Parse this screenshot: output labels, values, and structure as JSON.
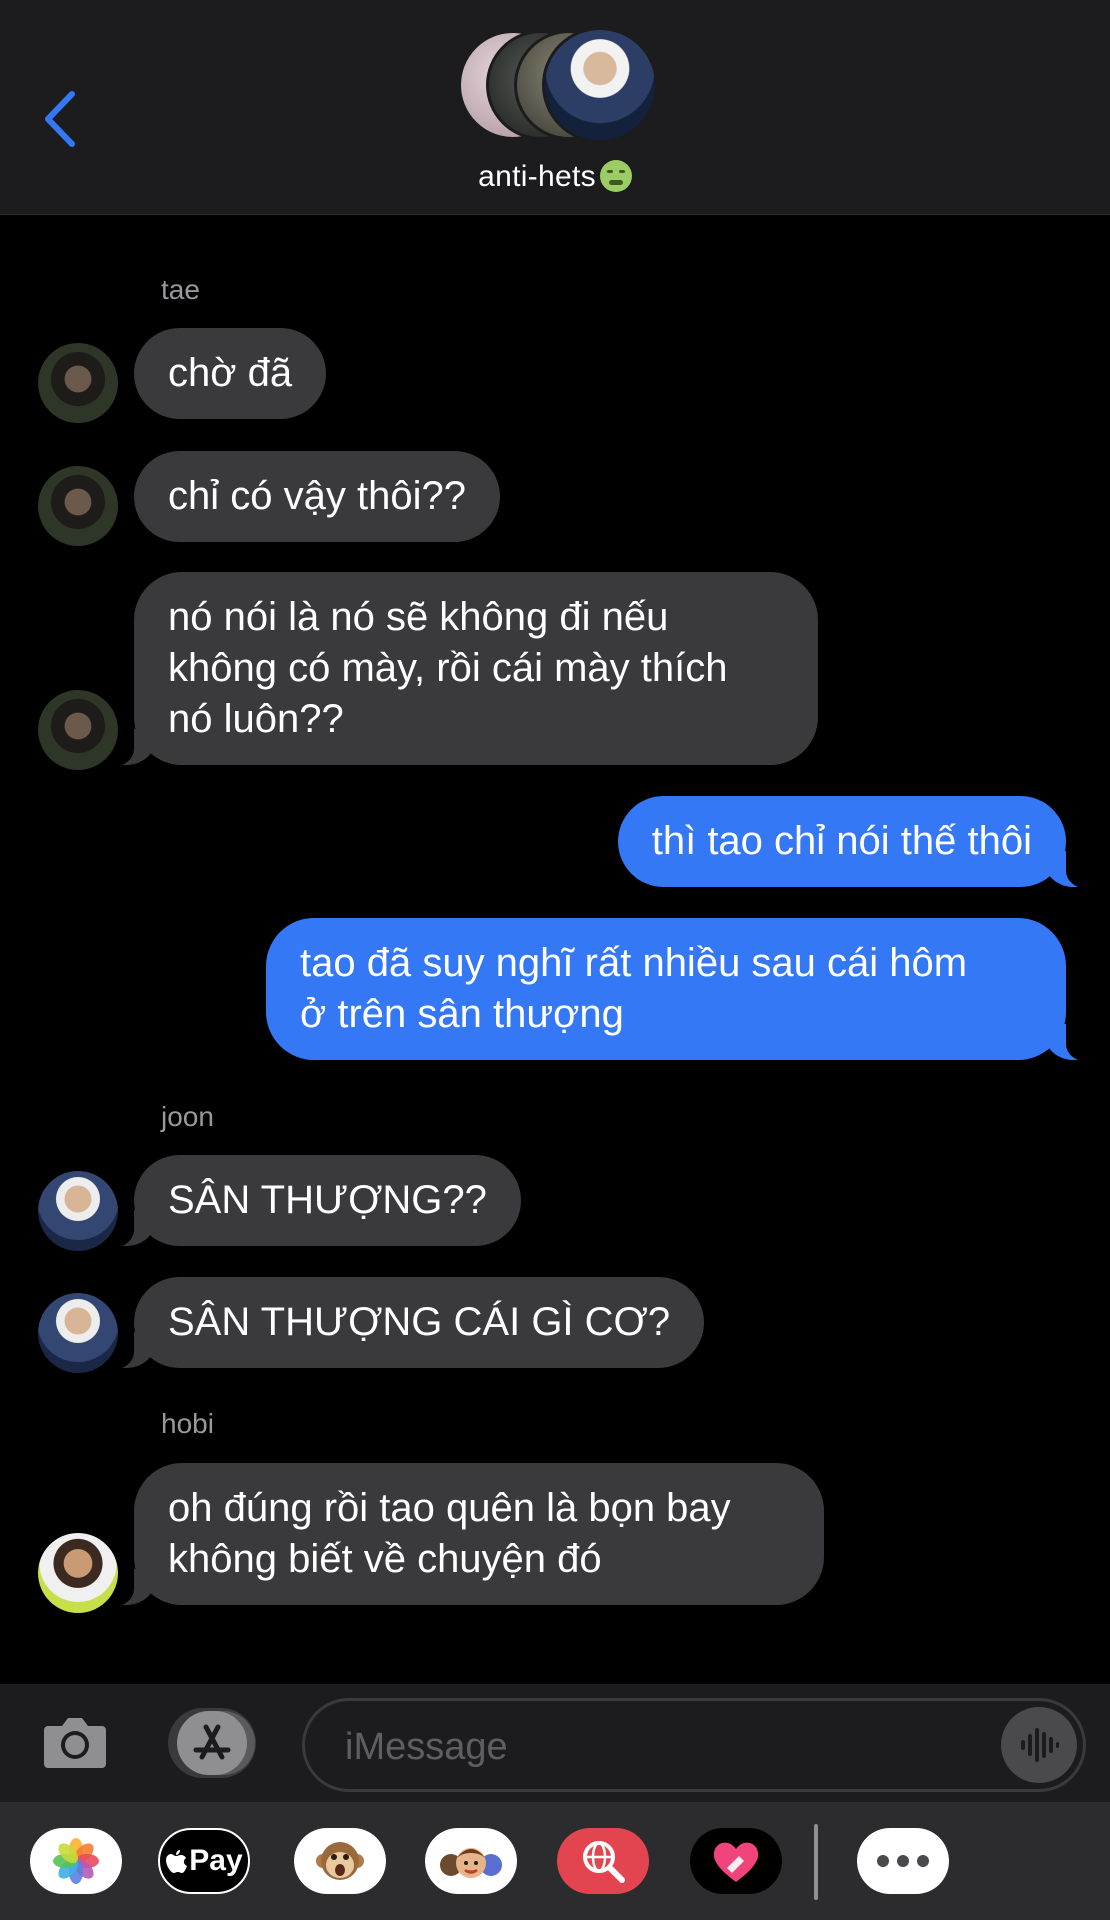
{
  "header": {
    "back_icon": "chevron-left-icon",
    "group_name": "anti-hets",
    "group_emoji": "nauseated-face-emoji"
  },
  "messages": [
    {
      "sender": "tae",
      "side": "in",
      "text": "chờ đã"
    },
    {
      "sender": "tae",
      "side": "in",
      "text": "chỉ có vậy thôi??"
    },
    {
      "sender": "tae",
      "side": "in",
      "text": "nó nói là nó sẽ không đi nếu\nkhông có mày, rồi cái mày thích\nnó luôn??"
    },
    {
      "sender": "me",
      "side": "out",
      "text": "thì tao chỉ nói thế thôi"
    },
    {
      "sender": "me",
      "side": "out",
      "text": "tao đã suy nghĩ rất nhiều sau cái hôm\nở trên sân thượng"
    },
    {
      "sender": "joon",
      "side": "in",
      "text": "SÂN THƯỢNG??"
    },
    {
      "sender": "joon",
      "side": "in",
      "text": "SÂN THƯỢNG CÁI GÌ CƠ?"
    },
    {
      "sender": "hobi",
      "side": "in",
      "text": "oh đúng rồi tao quên là bọn bay\nkhông biết về chuyện đó"
    }
  ],
  "sender_labels": {
    "tae": "tae",
    "joon": "joon",
    "hobi": "hobi"
  },
  "input": {
    "placeholder": "iMessage",
    "value": ""
  },
  "app_drawer": {
    "pay_label": "Pay",
    "items": [
      "photos-icon",
      "apple-pay-icon",
      "animoji-icon",
      "memoji-icon",
      "web-search-icon",
      "digital-touch-icon",
      "more-icon"
    ]
  },
  "colors": {
    "incoming_bubble": "#3a3a3c",
    "outgoing_bubble": "#3478f6",
    "accent": "#3478f6"
  }
}
